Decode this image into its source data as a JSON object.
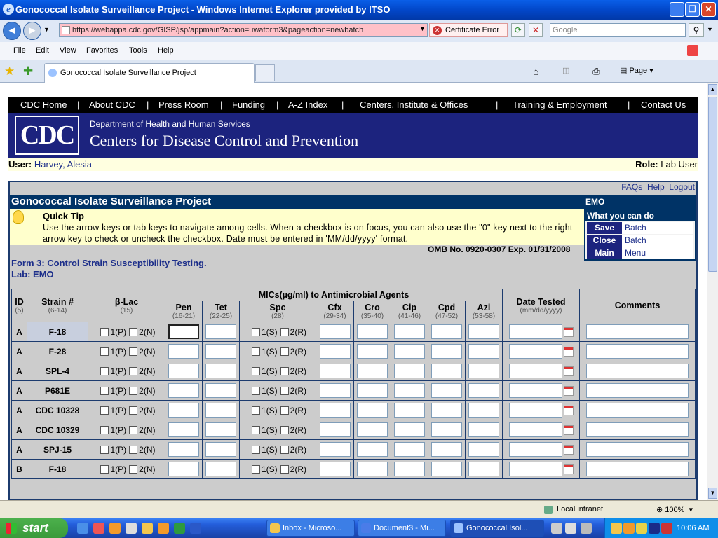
{
  "window": {
    "title": "Gonococcal Isolate Surveillance Project - Windows Internet Explorer provided by ITSO"
  },
  "address": {
    "url": "https://webappa.cdc.gov/GISP/jsp/appmain?action=uwaform3&pageaction=newbatch",
    "cert_label": "Certificate Error",
    "search_placeholder": "Google"
  },
  "menu": {
    "items": [
      "File",
      "Edit",
      "View",
      "Favorites",
      "Tools",
      "Help"
    ]
  },
  "tab": {
    "label": "Gonococcal Isolate Surveillance Project",
    "page_label": "Page"
  },
  "cdc_nav": {
    "items": [
      "CDC Home",
      "|",
      "About CDC",
      "|",
      "Press Room",
      "|",
      "Funding",
      "|",
      "A-Z Index",
      "|",
      "Centers, Institute & Offices",
      "|",
      "Training & Employment",
      "|",
      "Contact Us"
    ]
  },
  "banner": {
    "logo": "CDC",
    "dept": "Department of Health and Human Services",
    "name": "Centers for Disease Control and Prevention"
  },
  "user": {
    "label": "User:",
    "name": "Harvey, Alesia",
    "role_label": "Role:",
    "role": "Lab User"
  },
  "links": {
    "faqs": "FAQs",
    "help": "Help",
    "logout": "Logout"
  },
  "project": {
    "title": "Gonococcal Isolate Surveillance Project",
    "lab_code": "EMO"
  },
  "tip": {
    "title": "Quick Tip",
    "text": "Use the arrow keys or tab keys to navigate among cells. When a checkbox is on focus, you can also use the \"0\" key next to the right arrow key to check or uncheck the checkbox. Date must be entered in 'MM/dd/yyyy' format."
  },
  "omb": "OMB No. 0920-0307 Exp. 01/31/2008",
  "actions": {
    "header": "What you can do",
    "items": [
      {
        "key": "Save",
        "label": "Batch"
      },
      {
        "key": "Close",
        "label": "Batch"
      },
      {
        "key": "Main",
        "label": "Menu"
      }
    ]
  },
  "form": {
    "title": "Form 3: Control Strain Susceptibility Testing.",
    "lab": "Lab: EMO"
  },
  "table": {
    "mics_header": "MICs(µg/ml) to Antimicrobial Agents",
    "id_header": "ID",
    "id_sub": "(5)",
    "strain_header": "Strain #",
    "strain_sub": "(6-14)",
    "blac_header": "β-Lac",
    "blac_sub": "(15)",
    "date_header": "Date Tested",
    "date_sub": "(mm/dd/yyyy)",
    "comments_header": "Comments",
    "agents": [
      {
        "name": "Pen",
        "sub": "(16-21)"
      },
      {
        "name": "Tet",
        "sub": "(22-25)"
      },
      {
        "name": "Spc",
        "sub": "(28)"
      },
      {
        "name": "Cfx",
        "sub": "(29-34)"
      },
      {
        "name": "Cro",
        "sub": "(35-40)"
      },
      {
        "name": "Cip",
        "sub": "(41-46)"
      },
      {
        "name": "Cpd",
        "sub": "(47-52)"
      },
      {
        "name": "Azi",
        "sub": "(53-58)"
      }
    ],
    "blac_opts": [
      "1(P)",
      "2(N)"
    ],
    "spc_opts": [
      "1(S)",
      "2(R)"
    ],
    "rows": [
      {
        "id": "A",
        "strain": "F-18"
      },
      {
        "id": "A",
        "strain": "F-28"
      },
      {
        "id": "A",
        "strain": "SPL-4"
      },
      {
        "id": "A",
        "strain": "P681E"
      },
      {
        "id": "A",
        "strain": "CDC 10328"
      },
      {
        "id": "A",
        "strain": "CDC 10329"
      },
      {
        "id": "A",
        "strain": "SPJ-15"
      },
      {
        "id": "B",
        "strain": "F-18"
      }
    ]
  },
  "status": {
    "zone": "Local intranet",
    "zoom": "100%"
  },
  "taskbar": {
    "start": "start",
    "tasks": [
      "Inbox - Microso...",
      "Document3 - Mi...",
      "Gonococcal Isol..."
    ],
    "time": "10:06 AM"
  }
}
